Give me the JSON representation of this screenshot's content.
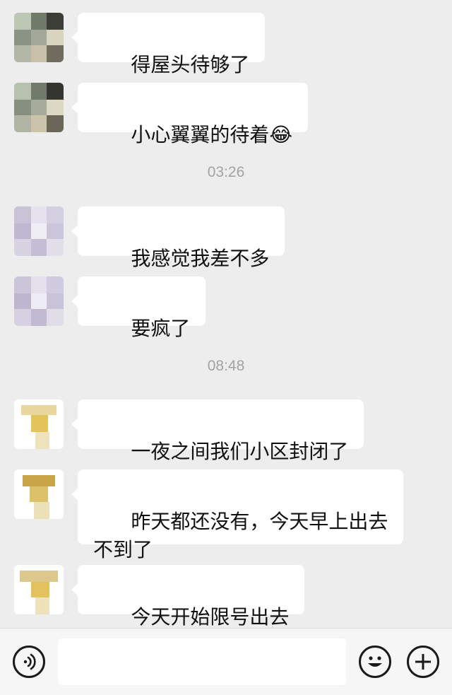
{
  "messages": [
    {
      "text": "得屋头待够了"
    },
    {
      "text": "小心翼翼的待着",
      "emoji": "😂"
    },
    {
      "text": "我感觉我差不多"
    },
    {
      "text": "要疯了"
    },
    {
      "text": "一夜之间我们小区封闭了"
    },
    {
      "text": "昨天都还没有，今天早上出去\n不到了"
    },
    {
      "text": "今天开始限号出去"
    }
  ],
  "timestamps": [
    "03:26",
    "08:48"
  ],
  "input_bar": {
    "voice_icon": "voice-icon",
    "emoji_icon": "emoji-icon",
    "add_icon": "add-icon",
    "text_value": ""
  },
  "colors": {
    "background": "#ededed",
    "bubble": "#ffffff",
    "timestamp": "#a3a3a3",
    "input_bar": "#f6f6f6"
  }
}
